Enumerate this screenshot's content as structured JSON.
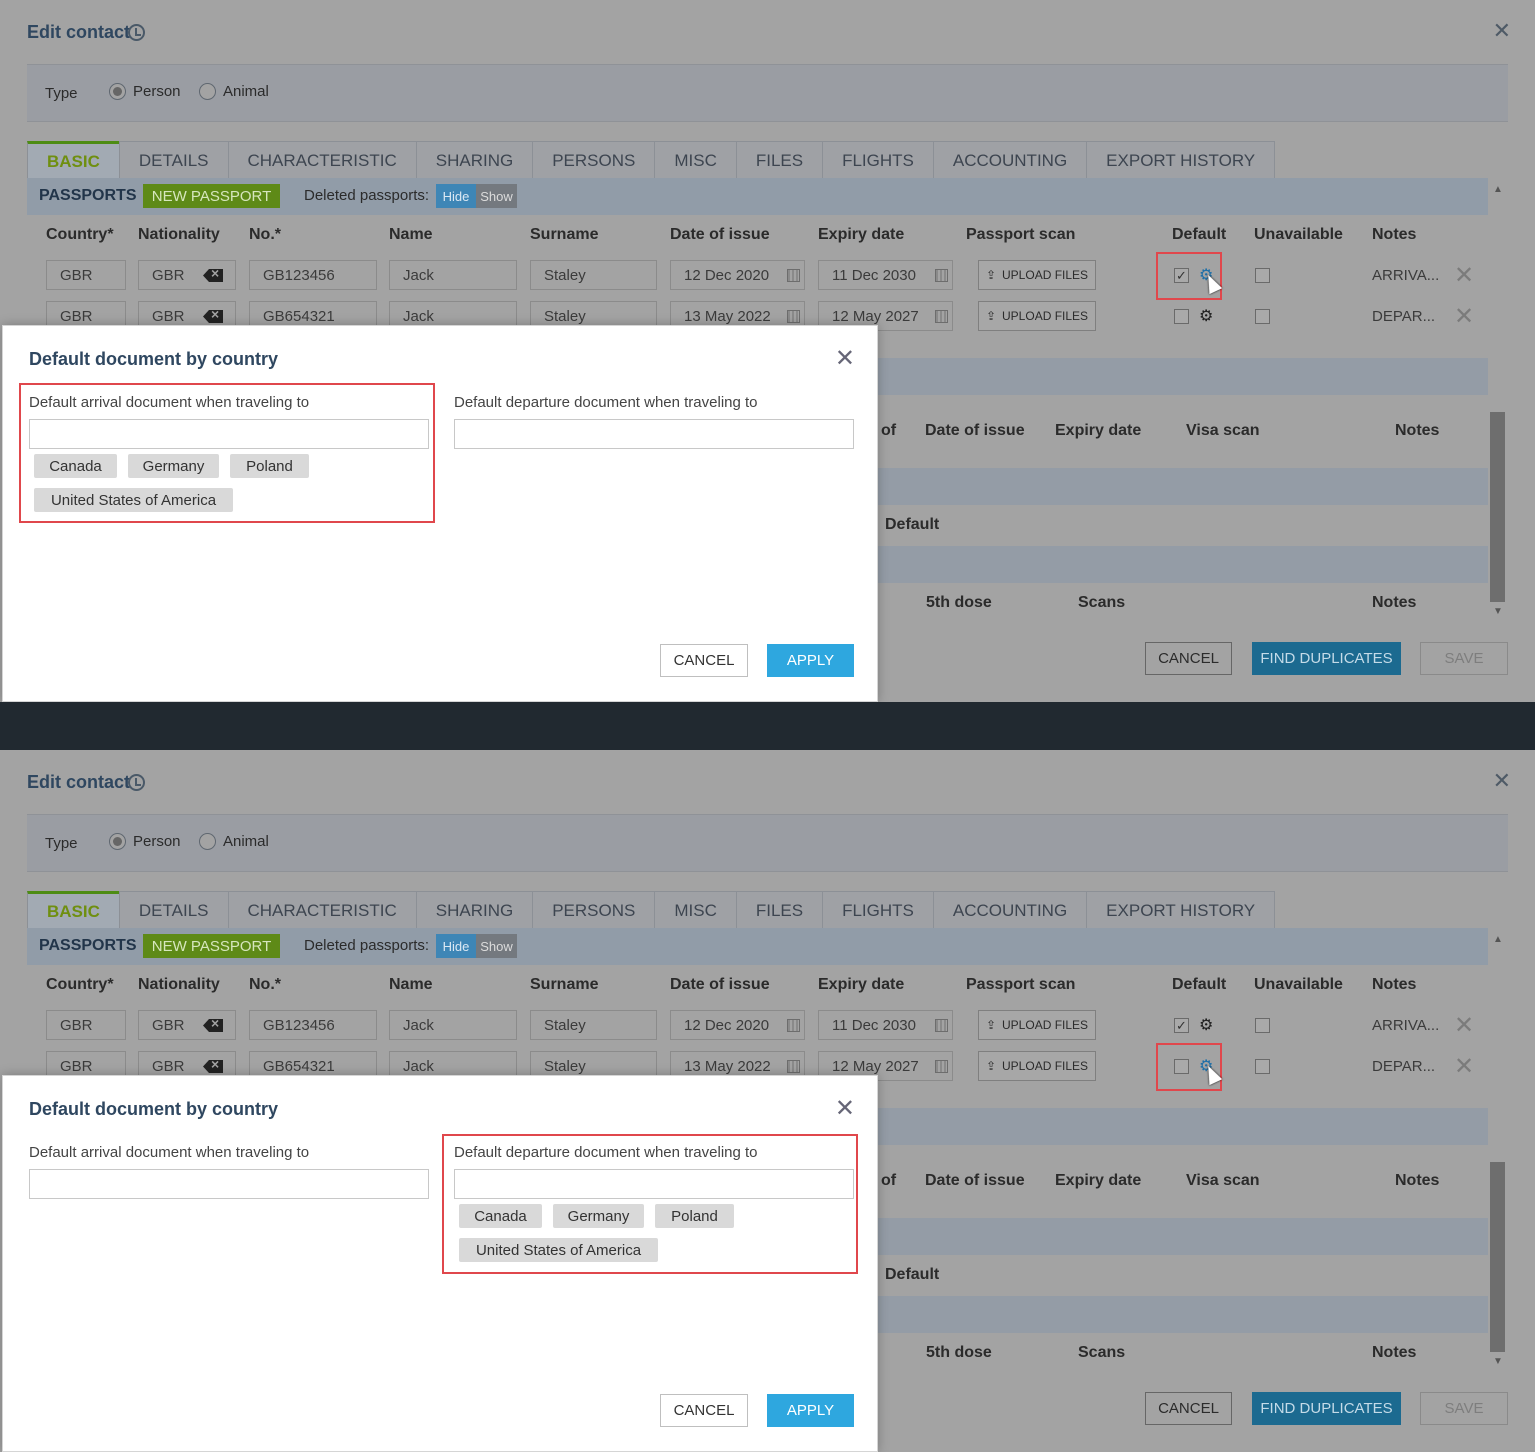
{
  "window": {
    "title": "Edit contact"
  },
  "type": {
    "label": "Type",
    "options": [
      "Person",
      "Animal"
    ],
    "selected": "Person"
  },
  "tabs": [
    "BASIC",
    "DETAILS",
    "CHARACTERISTIC",
    "SHARING",
    "PERSONS",
    "MISC",
    "FILES",
    "FLIGHTS",
    "ACCOUNTING",
    "EXPORT HISTORY"
  ],
  "passports": {
    "title": "PASSPORTS",
    "new_button": "NEW PASSPORT",
    "deleted_label": "Deleted passports:",
    "hide": "Hide",
    "show": "Show",
    "columns": [
      "Country*",
      "Nationality",
      "No.*",
      "Name",
      "Surname",
      "Date of issue",
      "Expiry date",
      "Passport scan",
      "Default",
      "Unavailable",
      "Notes"
    ],
    "upload_label": "UPLOAD FILES",
    "rows": [
      {
        "country": "GBR",
        "nationality": "GBR",
        "no": "GB123456",
        "name": "Jack",
        "surname": "Staley",
        "issue": "12 Dec 2020",
        "expiry": "11 Dec 2030",
        "default": true,
        "unavailable": false,
        "notes": "ARRIVA..."
      },
      {
        "country": "GBR",
        "nationality": "GBR",
        "no": "GB654321",
        "name": "Jack",
        "surname": "Staley",
        "issue": "13 May 2022",
        "expiry": "12 May 2027",
        "default": false,
        "unavailable": false,
        "notes": "DEPAR..."
      }
    ]
  },
  "visas": {
    "col_of": "of",
    "col_issue": "Date of issue",
    "col_expiry": "Expiry date",
    "col_scan": "Visa scan",
    "col_notes": "Notes"
  },
  "other": {
    "default": "Default"
  },
  "vacc": {
    "dose": "5th dose",
    "scans": "Scans",
    "notes": "Notes"
  },
  "footer": {
    "cancel": "CANCEL",
    "find": "FIND DUPLICATES",
    "save": "SAVE"
  },
  "dialog": {
    "title": "Default document by country",
    "arrival_label": "Default arrival document when traveling to",
    "departure_label": "Default departure document when traveling to",
    "cancel": "CANCEL",
    "apply": "APPLY"
  },
  "countries": [
    "Canada",
    "Germany",
    "Poland",
    "United States of America"
  ]
}
